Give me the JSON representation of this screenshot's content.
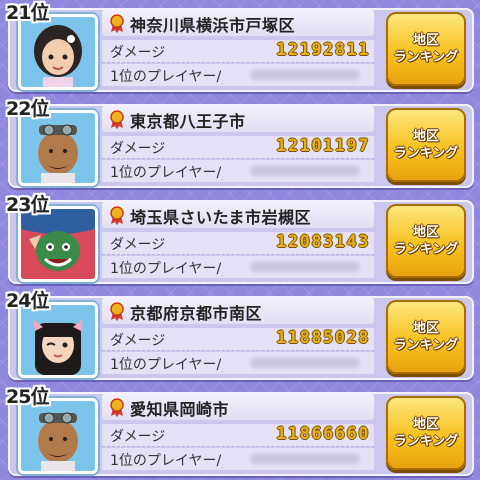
{
  "rankings": [
    {
      "rank": "21位",
      "area": "神奈川県横浜市戸塚区",
      "damage_label": "ダメージ",
      "damage": "12192811",
      "player_label": "1位のプレイヤー/",
      "button_line1": "地区",
      "button_line2": "ランキング"
    },
    {
      "rank": "22位",
      "area": "東京都八王子市",
      "damage_label": "ダメージ",
      "damage": "12101197",
      "player_label": "1位のプレイヤー/",
      "button_line1": "地区",
      "button_line2": "ランキング"
    },
    {
      "rank": "23位",
      "area": "埼玉県さいたま市岩槻区",
      "damage_label": "ダメージ",
      "damage": "12083143",
      "player_label": "1位のプレイヤー/",
      "button_line1": "地区",
      "button_line2": "ランキング"
    },
    {
      "rank": "24位",
      "area": "京都府京都市南区",
      "damage_label": "ダメージ",
      "damage": "11885028",
      "player_label": "1位のプレイヤー/",
      "button_line1": "地区",
      "button_line2": "ランキング"
    },
    {
      "rank": "25位",
      "area": "愛知県岡崎市",
      "damage_label": "ダメージ",
      "damage": "11866660",
      "player_label": "1位のプレイヤー/",
      "button_line1": "地区",
      "button_line2": "ランキング"
    }
  ],
  "colors": {
    "card": "#cdc6ee",
    "damage_value": "#e8b01a",
    "button": "#f7c21c",
    "background": "#8f86de"
  }
}
